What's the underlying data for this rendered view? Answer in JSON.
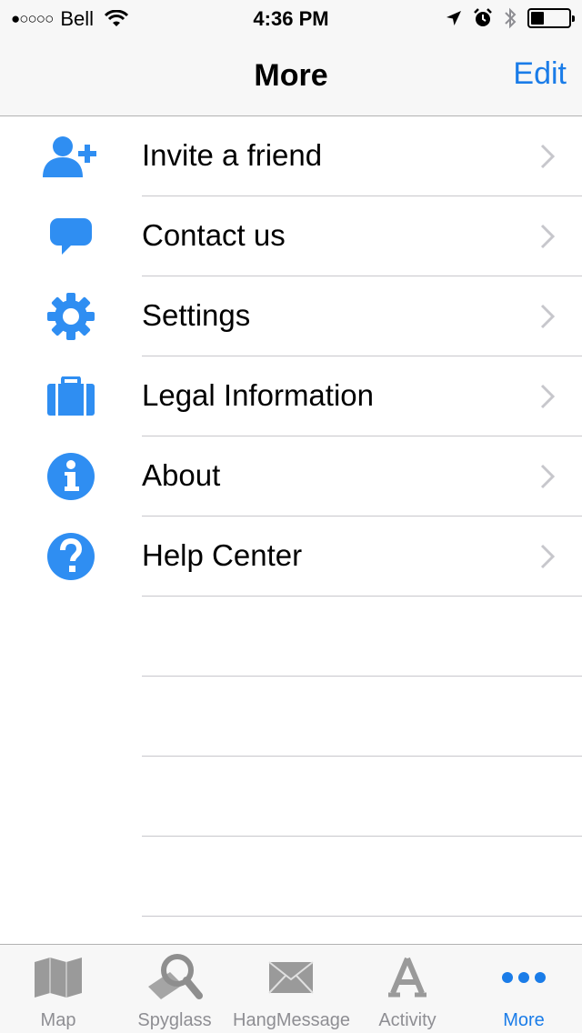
{
  "status": {
    "signal": "●○○○○",
    "carrier": "Bell",
    "time": "4:36 PM"
  },
  "nav": {
    "title": "More",
    "edit_label": "Edit"
  },
  "colors": {
    "accent": "#1a7ce8",
    "icon_blue": "#2f8ef2",
    "tab_inactive": "#8e8e93"
  },
  "menu": {
    "items": [
      {
        "label": "Invite a friend",
        "icon": "add-user-icon"
      },
      {
        "label": "Contact us",
        "icon": "speech-bubble-icon"
      },
      {
        "label": "Settings",
        "icon": "gear-icon"
      },
      {
        "label": "Legal Information",
        "icon": "briefcase-icon"
      },
      {
        "label": "About",
        "icon": "info-icon"
      },
      {
        "label": "Help Center",
        "icon": "question-icon"
      }
    ]
  },
  "tabs": [
    {
      "label": "Map",
      "icon": "map-icon"
    },
    {
      "label": "Spyglass",
      "icon": "spyglass-icon"
    },
    {
      "label": "HangMessage",
      "icon": "envelope-icon"
    },
    {
      "label": "Activity",
      "icon": "letter-a-icon"
    },
    {
      "label": "More",
      "icon": "more-dots-icon",
      "active": true
    }
  ]
}
